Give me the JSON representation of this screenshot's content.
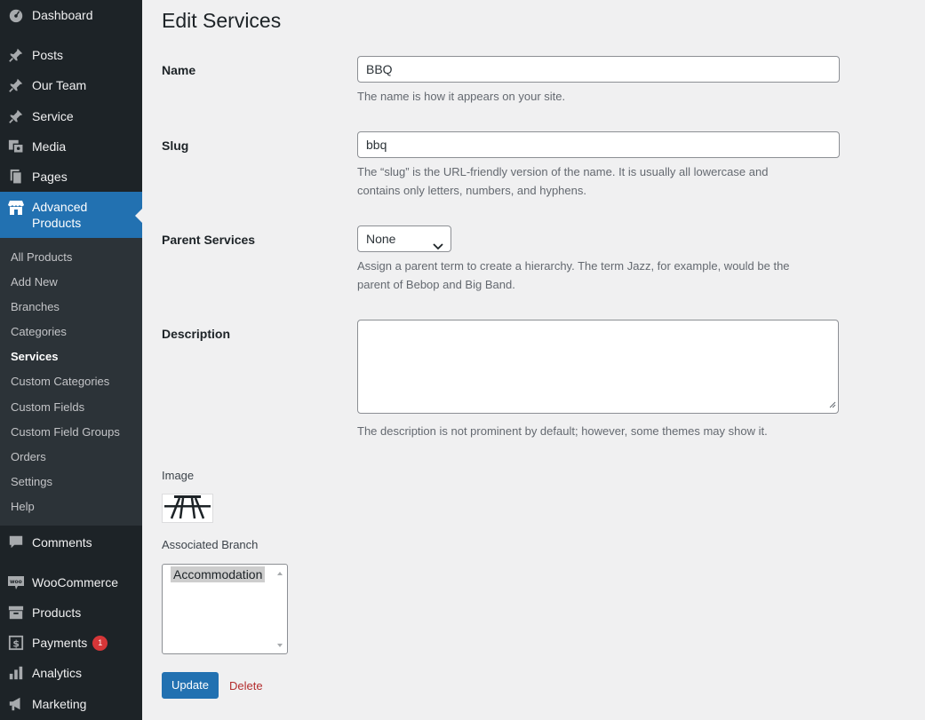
{
  "sidebar": {
    "items": [
      {
        "label": "Dashboard",
        "icon": "dashboard-icon"
      },
      {
        "label": "Posts",
        "icon": "pin-icon"
      },
      {
        "label": "Our Team",
        "icon": "pin-icon"
      },
      {
        "label": "Service",
        "icon": "pin-icon"
      },
      {
        "label": "Media",
        "icon": "media-icon"
      },
      {
        "label": "Pages",
        "icon": "pages-icon"
      },
      {
        "label": "Advanced Products",
        "icon": "store-icon"
      },
      {
        "label": "Comments",
        "icon": "comment-icon"
      },
      {
        "label": "WooCommerce",
        "icon": "woo-icon"
      },
      {
        "label": "Products",
        "icon": "archive-icon"
      },
      {
        "label": "Payments",
        "icon": "payments-icon",
        "badge": "1"
      },
      {
        "label": "Analytics",
        "icon": "analytics-icon"
      },
      {
        "label": "Marketing",
        "icon": "megaphone-icon"
      }
    ],
    "submenu": [
      "All Products",
      "Add New",
      "Branches",
      "Categories",
      "Services",
      "Custom Categories",
      "Custom Fields",
      "Custom Field Groups",
      "Orders",
      "Settings",
      "Help"
    ],
    "current_submenu": "Services"
  },
  "page": {
    "title": "Edit Services"
  },
  "form": {
    "name": {
      "label": "Name",
      "value": "BBQ",
      "help": "The name is how it appears on your site."
    },
    "slug": {
      "label": "Slug",
      "value": "bbq",
      "help_line1": "The “slug” is the URL-friendly version of the name. It is usually all lowercase and",
      "help_line2": "contains only letters, numbers, and hyphens."
    },
    "parent": {
      "label": "Parent Services",
      "value": "None",
      "help_line1": "Assign a parent term to create a hierarchy. The term Jazz, for example, would be the",
      "help_line2": "parent of Bebop and Big Band."
    },
    "description": {
      "label": "Description",
      "value": "",
      "help": "The description is not prominent by default; however, some themes may show it."
    },
    "image": {
      "label": "Image",
      "icon": "picnic-table-icon"
    },
    "branch": {
      "label": "Associated Branch",
      "options": [
        "Accommodation"
      ]
    },
    "update_label": "Update",
    "delete_label": "Delete"
  },
  "colors": {
    "sidebar_bg": "#1d2327",
    "submenu_bg": "#2c3338",
    "accent": "#2271b1",
    "delete": "#b32d2e",
    "badge": "#d63638"
  }
}
